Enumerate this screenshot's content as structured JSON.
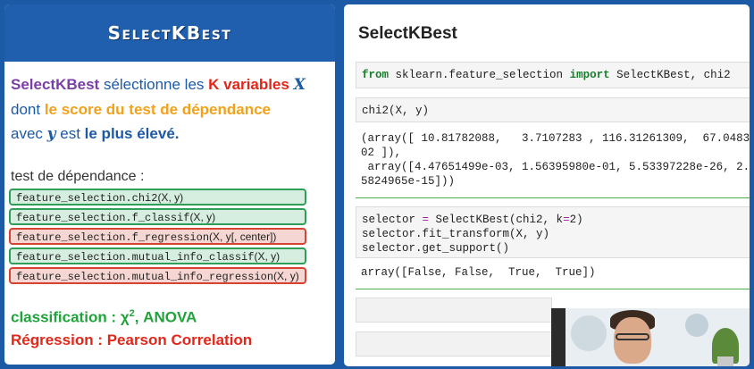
{
  "slide": {
    "title": "SelectKBest",
    "intro": {
      "w1": "SelectKBest",
      "w2": " sélectionne les ",
      "w3": "K variables ",
      "w4": "X",
      "w5": "dont ",
      "w6": "le score du test de dépendance",
      "w7": "avec ",
      "w8": "y",
      "w9": " est ",
      "w10": "le plus élevé."
    },
    "test_label": "test de dépendance :",
    "functions": [
      {
        "name": "feature_selection.chi2",
        "args": "(X, y)",
        "color": "#2f9e57"
      },
      {
        "name": "feature_selection.f_classif",
        "args": "(X, y)",
        "color": "#2f9e57"
      },
      {
        "name": "feature_selection.f_regression",
        "args": "(X, y[, center])",
        "color": "#d74333"
      },
      {
        "name": "feature_selection.mutual_info_classif",
        "args": "(X, y)",
        "color": "#2f9e57"
      },
      {
        "name": "feature_selection.mutual_info_regression",
        "args": "(X, y)",
        "color": "#d74333"
      }
    ],
    "classification_prefix": "classification : χ",
    "classification_sup": "2",
    "classification_suffix": ", ANOVA",
    "regression": "Régression : Pearson Correlation"
  },
  "notebook": {
    "title": "SelectKBest",
    "cell1": {
      "kw1": "from",
      "mid": " sklearn.feature_selection ",
      "kw2": "import",
      "rest": " SelectKBest, chi2"
    },
    "cell2": "chi2(X, y)",
    "out2_l1": "(array([ 10.81782088,   3.7107283 , 116.31261309,  67.0483",
    "out2_l2": "02 ]),",
    "out2_l3": " array([4.47651499e-03, 1.56395980e-01, 5.53397228e-26, 2.",
    "out2_l4": "5824965e-15]))",
    "cell3_l1a": "selector ",
    "cell3_l1op": "=",
    "cell3_l1b": " SelectKBest(chi2, k",
    "cell3_l1op2": "=",
    "cell3_l1c": "2)",
    "cell3_l2": "selector.fit_transform(X, y)",
    "cell3_l3": "selector.get_support()",
    "out3": "array([False, False,  True,  True])"
  },
  "colors": {
    "brand_blue": "#1d5aa6",
    "accent_green": "#1fa33a",
    "accent_red": "#e2261a",
    "accent_orange": "#f2a21a",
    "accent_purple": "#7b3fa6"
  }
}
